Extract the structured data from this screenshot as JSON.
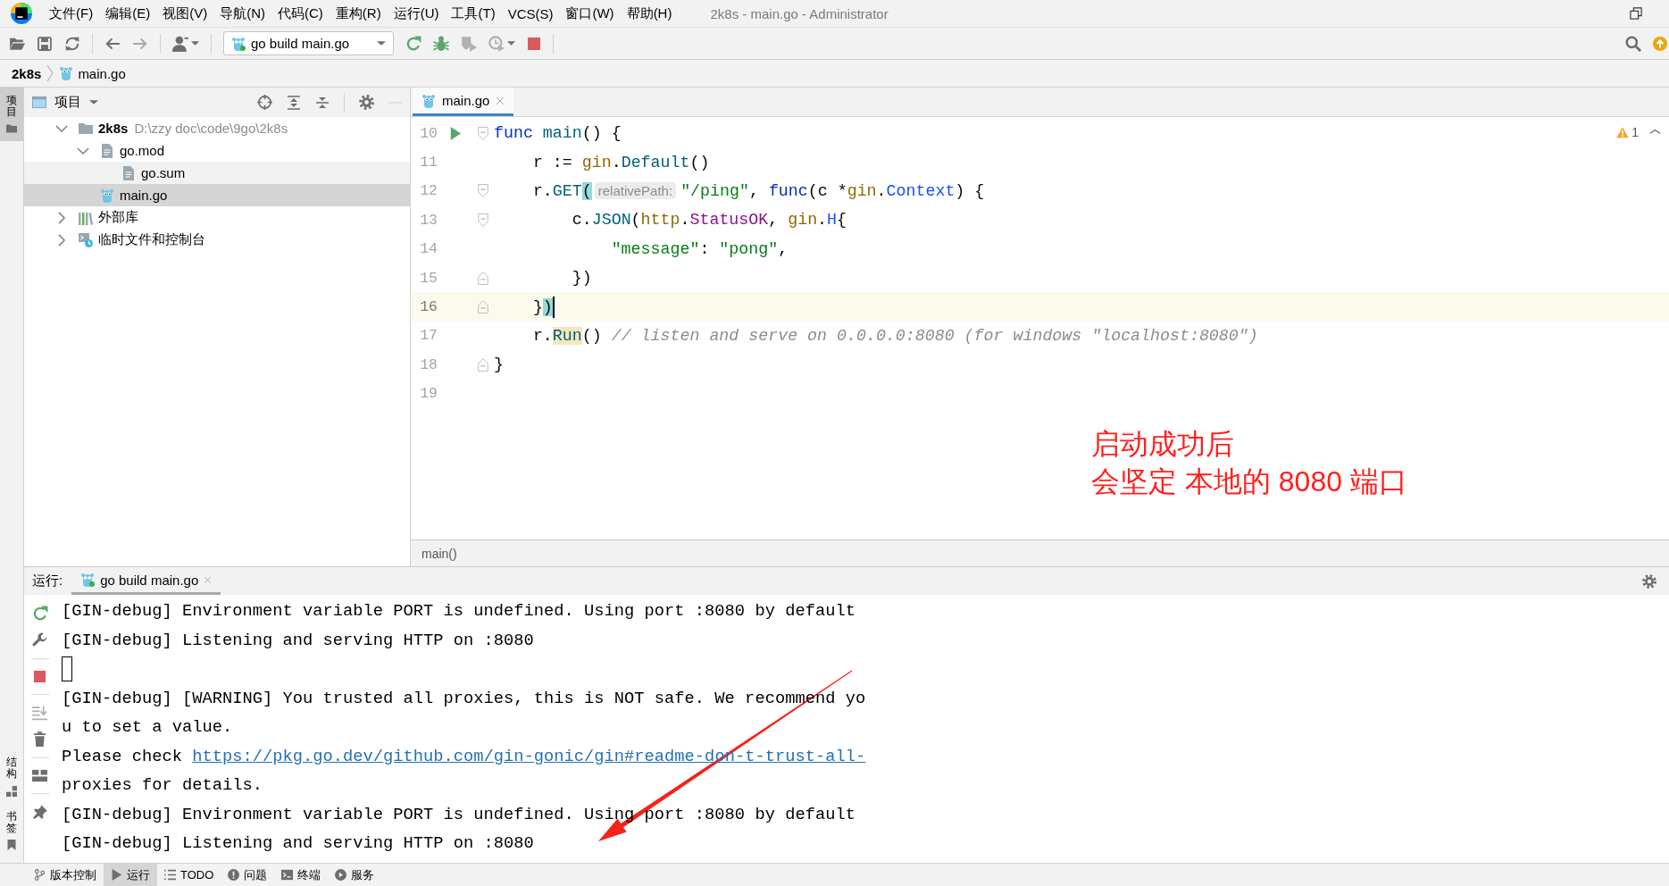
{
  "window": {
    "title": "2k8s - main.go - Administrator"
  },
  "menu": [
    "文件(F)",
    "编辑(E)",
    "视图(V)",
    "导航(N)",
    "代码(C)",
    "重构(R)",
    "运行(U)",
    "工具(T)",
    "VCS(S)",
    "窗口(W)",
    "帮助(H)"
  ],
  "toolbar": {
    "run_configuration": "go build main.go"
  },
  "navigation_bar": [
    {
      "label": "2k8s",
      "kind": "project"
    },
    {
      "label": "main.go",
      "kind": "gofile"
    }
  ],
  "tool_stripe": {
    "top": [
      {
        "label": "项目",
        "kind": "project",
        "selected": true
      }
    ],
    "bottom": [
      {
        "label": "结构",
        "kind": "structure",
        "selected": false
      },
      {
        "label": "书签",
        "kind": "bookmarks",
        "selected": false
      }
    ]
  },
  "project_panel": {
    "title": "项目",
    "tree": [
      {
        "label": "2k8s",
        "kind": "project",
        "path": "D:\\zzy doc\\code\\9go\\2k8s",
        "expanded": true,
        "selected": false,
        "hovered": false,
        "children": [
          {
            "label": "go.mod",
            "kind": "file",
            "expanded": true,
            "selected": false,
            "hovered": false,
            "children": [
              {
                "label": "go.sum",
                "kind": "file",
                "selected": false,
                "hovered": true
              }
            ]
          },
          {
            "label": "main.go",
            "kind": "gofile",
            "selected": true,
            "hovered": false
          }
        ]
      },
      {
        "label": "外部库",
        "kind": "library",
        "expanded": false,
        "selected": false,
        "hovered": false
      },
      {
        "label": "临时文件和控制台",
        "kind": "scratch",
        "expanded": false,
        "selected": false,
        "hovered": false
      }
    ]
  },
  "editor": {
    "tabs": [
      {
        "label": "main.go",
        "selected": true
      }
    ],
    "warnings": "1",
    "lines": [
      {
        "number": "10",
        "run": true,
        "fold_start": true,
        "fold_end": false,
        "current": false,
        "caret": false,
        "tokens": [
          {
            "text": "func",
            "kind": "keyword"
          },
          {
            "text": " main",
            "kind": "function"
          },
          {
            "text": "() {",
            "kind": "plain"
          }
        ]
      },
      {
        "number": "11",
        "run": false,
        "fold_start": false,
        "fold_end": false,
        "current": false,
        "caret": false,
        "tokens": [
          {
            "text": "    r := ",
            "kind": "plain"
          },
          {
            "text": "gin",
            "kind": "package"
          },
          {
            "text": ".",
            "kind": "plain"
          },
          {
            "text": "Default",
            "kind": "method"
          },
          {
            "text": "()",
            "kind": "plain"
          }
        ]
      },
      {
        "number": "12",
        "run": false,
        "fold_start": true,
        "fold_end": false,
        "current": false,
        "caret": false,
        "tokens": [
          {
            "text": "    r.",
            "kind": "plain"
          },
          {
            "text": "GET",
            "kind": "method"
          },
          {
            "text": "(",
            "kind": "matched_bracket"
          },
          {
            "text": "relativePath:",
            "kind": "hint"
          },
          {
            "text": "\"/ping\"",
            "kind": "string"
          },
          {
            "text": ", ",
            "kind": "plain"
          },
          {
            "text": "func",
            "kind": "keyword"
          },
          {
            "text": "(c *",
            "kind": "plain"
          },
          {
            "text": "gin",
            "kind": "package"
          },
          {
            "text": ".",
            "kind": "plain"
          },
          {
            "text": "Context",
            "kind": "type"
          },
          {
            "text": ") {",
            "kind": "plain"
          }
        ]
      },
      {
        "number": "13",
        "run": false,
        "fold_start": true,
        "fold_end": false,
        "current": false,
        "caret": false,
        "tokens": [
          {
            "text": "        c.",
            "kind": "plain"
          },
          {
            "text": "JSON",
            "kind": "method"
          },
          {
            "text": "(",
            "kind": "plain"
          },
          {
            "text": "http",
            "kind": "package"
          },
          {
            "text": ".",
            "kind": "plain"
          },
          {
            "text": "StatusOK",
            "kind": "constant"
          },
          {
            "text": ", ",
            "kind": "plain"
          },
          {
            "text": "gin",
            "kind": "package"
          },
          {
            "text": ".",
            "kind": "plain"
          },
          {
            "text": "H",
            "kind": "type"
          },
          {
            "text": "{",
            "kind": "plain"
          }
        ]
      },
      {
        "number": "14",
        "run": false,
        "fold_start": false,
        "fold_end": false,
        "current": false,
        "caret": false,
        "tokens": [
          {
            "text": "            \"message\"",
            "kind": "string"
          },
          {
            "text": ": ",
            "kind": "plain"
          },
          {
            "text": "\"pong\"",
            "kind": "string"
          },
          {
            "text": ",",
            "kind": "plain"
          }
        ]
      },
      {
        "number": "15",
        "run": false,
        "fold_start": false,
        "fold_end": true,
        "current": false,
        "caret": false,
        "tokens": [
          {
            "text": "        })",
            "kind": "plain"
          }
        ]
      },
      {
        "number": "16",
        "run": false,
        "fold_start": false,
        "fold_end": true,
        "current": true,
        "caret": true,
        "tokens": [
          {
            "text": "    }",
            "kind": "plain"
          },
          {
            "text": ")",
            "kind": "matched_bracket"
          }
        ]
      },
      {
        "number": "17",
        "run": false,
        "fold_start": false,
        "fold_end": false,
        "current": false,
        "caret": false,
        "tokens": [
          {
            "text": "    r.",
            "kind": "plain"
          },
          {
            "text": "Run",
            "kind": "method_usage"
          },
          {
            "text": "() ",
            "kind": "plain"
          },
          {
            "text": "// listen and serve on 0.0.0.0:8080 (for windows \"localhost:8080\")",
            "kind": "comment"
          }
        ]
      },
      {
        "number": "18",
        "run": false,
        "fold_start": false,
        "fold_end": true,
        "current": false,
        "caret": false,
        "tokens": [
          {
            "text": "}",
            "kind": "plain"
          }
        ]
      },
      {
        "number": "19",
        "run": false,
        "fold_start": false,
        "fold_end": false,
        "current": false,
        "caret": false
      }
    ],
    "breadcrumb": "main()"
  },
  "run_panel": {
    "label": "运行:",
    "tabs": [
      {
        "label": "go build main.go",
        "selected": true
      }
    ],
    "output": [
      {
        "kind": "text",
        "text": "[GIN-debug] Environment variable PORT is undefined. Using port :8080 by default"
      },
      {
        "kind": "text",
        "text": "[GIN-debug] Listening and serving HTTP on :8080"
      },
      {
        "kind": "input_cursor"
      },
      {
        "kind": "text",
        "text": "[GIN-debug] [WARNING] You trusted all proxies, this is NOT safe. We recommend yo"
      },
      {
        "kind": "text",
        "text": "u to set a value."
      },
      {
        "kind": "link",
        "text": "Please check ",
        "link": "https://pkg.go.dev/github.com/gin-gonic/gin#readme-don-t-trust-all-"
      },
      {
        "kind": "text",
        "text": "proxies for details."
      },
      {
        "kind": "text",
        "text": "[GIN-debug] Environment variable PORT is undefined. Using port :8080 by default"
      },
      {
        "kind": "text",
        "text": "[GIN-debug] Listening and serving HTTP on :8080"
      }
    ]
  },
  "tool_window_bar": [
    {
      "label": "版本控制",
      "kind": "vcs",
      "selected": false
    },
    {
      "label": "运行",
      "kind": "run",
      "selected": true
    },
    {
      "label": "TODO",
      "kind": "todo",
      "selected": false
    },
    {
      "label": "问题",
      "kind": "problems",
      "selected": false
    },
    {
      "label": "终端",
      "kind": "terminal",
      "selected": false
    },
    {
      "label": "服务",
      "kind": "services",
      "selected": false
    }
  ],
  "annotation": {
    "lines": [
      "启动成功后",
      "会坚定 本地的 8080 端口"
    ]
  }
}
